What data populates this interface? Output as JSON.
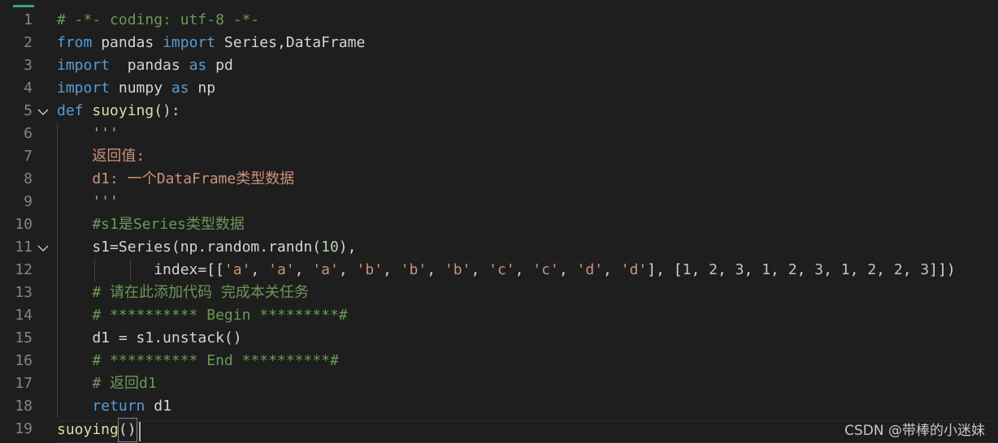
{
  "editor": {
    "lines": [
      {
        "n": "1",
        "fold": false,
        "tokens": [
          {
            "t": "# -*- coding: utf-8 -*-",
            "c": "com"
          }
        ]
      },
      {
        "n": "2",
        "fold": false,
        "tokens": [
          {
            "t": "from",
            "c": "kw"
          },
          {
            "t": " pandas ",
            "c": "plain"
          },
          {
            "t": "import",
            "c": "kw"
          },
          {
            "t": " Series,DataFrame",
            "c": "plain"
          }
        ]
      },
      {
        "n": "3",
        "fold": false,
        "tokens": [
          {
            "t": "import",
            "c": "kw"
          },
          {
            "t": "  pandas ",
            "c": "plain"
          },
          {
            "t": "as",
            "c": "kw"
          },
          {
            "t": " pd",
            "c": "plain"
          }
        ]
      },
      {
        "n": "4",
        "fold": false,
        "tokens": [
          {
            "t": "import",
            "c": "kw"
          },
          {
            "t": " numpy ",
            "c": "plain"
          },
          {
            "t": "as",
            "c": "kw"
          },
          {
            "t": " np",
            "c": "plain"
          }
        ]
      },
      {
        "n": "5",
        "fold": true,
        "tokens": [
          {
            "t": "def",
            "c": "kw"
          },
          {
            "t": " ",
            "c": "plain"
          },
          {
            "t": "suoying",
            "c": "fn"
          },
          {
            "t": "():",
            "c": "plain"
          }
        ]
      },
      {
        "n": "6",
        "fold": false,
        "tokens": [
          {
            "t": "    '''",
            "c": "str"
          }
        ]
      },
      {
        "n": "7",
        "fold": false,
        "tokens": [
          {
            "t": "    返回值:",
            "c": "str"
          }
        ]
      },
      {
        "n": "8",
        "fold": false,
        "tokens": [
          {
            "t": "    d1: 一个DataFrame类型数据",
            "c": "str"
          }
        ]
      },
      {
        "n": "9",
        "fold": false,
        "tokens": [
          {
            "t": "    '''",
            "c": "str"
          }
        ]
      },
      {
        "n": "10",
        "fold": false,
        "tokens": [
          {
            "t": "    #s1是Series类型数据",
            "c": "com"
          }
        ]
      },
      {
        "n": "11",
        "fold": true,
        "tokens": [
          {
            "t": "    s1=Series(np.random.randn(",
            "c": "plain"
          },
          {
            "t": "10",
            "c": "num"
          },
          {
            "t": "),",
            "c": "plain"
          }
        ]
      },
      {
        "n": "12",
        "fold": false,
        "tokens": [
          {
            "t": "           index=[[",
            "c": "plain"
          },
          {
            "t": "'a'",
            "c": "str"
          },
          {
            "t": ", ",
            "c": "plain"
          },
          {
            "t": "'a'",
            "c": "str"
          },
          {
            "t": ", ",
            "c": "plain"
          },
          {
            "t": "'a'",
            "c": "str"
          },
          {
            "t": ", ",
            "c": "plain"
          },
          {
            "t": "'b'",
            "c": "str"
          },
          {
            "t": ", ",
            "c": "plain"
          },
          {
            "t": "'b'",
            "c": "str"
          },
          {
            "t": ", ",
            "c": "plain"
          },
          {
            "t": "'b'",
            "c": "str"
          },
          {
            "t": ", ",
            "c": "plain"
          },
          {
            "t": "'c'",
            "c": "str"
          },
          {
            "t": ", ",
            "c": "plain"
          },
          {
            "t": "'c'",
            "c": "str"
          },
          {
            "t": ", ",
            "c": "plain"
          },
          {
            "t": "'d'",
            "c": "str"
          },
          {
            "t": ", ",
            "c": "plain"
          },
          {
            "t": "'d'",
            "c": "str"
          },
          {
            "t": "], [",
            "c": "plain"
          },
          {
            "t": "1",
            "c": "num"
          },
          {
            "t": ", ",
            "c": "plain"
          },
          {
            "t": "2",
            "c": "num"
          },
          {
            "t": ", ",
            "c": "plain"
          },
          {
            "t": "3",
            "c": "num"
          },
          {
            "t": ", ",
            "c": "plain"
          },
          {
            "t": "1",
            "c": "num"
          },
          {
            "t": ", ",
            "c": "plain"
          },
          {
            "t": "2",
            "c": "num"
          },
          {
            "t": ", ",
            "c": "plain"
          },
          {
            "t": "3",
            "c": "num"
          },
          {
            "t": ", ",
            "c": "plain"
          },
          {
            "t": "1",
            "c": "num"
          },
          {
            "t": ", ",
            "c": "plain"
          },
          {
            "t": "2",
            "c": "num"
          },
          {
            "t": ", ",
            "c": "plain"
          },
          {
            "t": "2",
            "c": "num"
          },
          {
            "t": ", ",
            "c": "plain"
          },
          {
            "t": "3",
            "c": "num"
          },
          {
            "t": "]])",
            "c": "plain"
          }
        ]
      },
      {
        "n": "13",
        "fold": false,
        "tokens": [
          {
            "t": "    # 请在此添加代码 完成本关任务",
            "c": "com"
          }
        ]
      },
      {
        "n": "14",
        "fold": false,
        "tokens": [
          {
            "t": "    # ********** Begin *********#",
            "c": "com"
          }
        ]
      },
      {
        "n": "15",
        "fold": false,
        "tokens": [
          {
            "t": "    d1 = s1.unstack()",
            "c": "plain"
          }
        ]
      },
      {
        "n": "16",
        "fold": false,
        "tokens": [
          {
            "t": "    # ********** End **********#",
            "c": "com"
          }
        ]
      },
      {
        "n": "17",
        "fold": false,
        "tokens": [
          {
            "t": "    # 返回d1",
            "c": "com"
          }
        ]
      },
      {
        "n": "18",
        "fold": false,
        "tokens": [
          {
            "t": "    ",
            "c": "plain"
          },
          {
            "t": "return",
            "c": "kw"
          },
          {
            "t": " d1",
            "c": "plain"
          }
        ]
      },
      {
        "n": "19",
        "fold": false,
        "tokens": [
          {
            "t": "suoying",
            "c": "fn"
          },
          {
            "t": "()",
            "c": "plain",
            "box": true
          }
        ]
      }
    ],
    "fold_icon": "chevron-down-icon"
  },
  "watermark": "CSDN @带棒的小迷妹"
}
